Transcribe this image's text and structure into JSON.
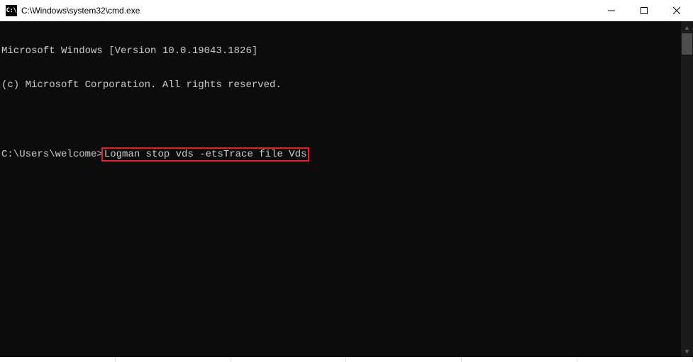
{
  "titlebar": {
    "icon_label": "C:\\",
    "title": "C:\\Windows\\system32\\cmd.exe"
  },
  "window_controls": {
    "minimize": "Minimize",
    "maximize": "Maximize",
    "close": "Close"
  },
  "terminal": {
    "line1": "Microsoft Windows [Version 10.0.19043.1826]",
    "line2": "(c) Microsoft Corporation. All rights reserved.",
    "blank": "",
    "prompt": "C:\\Users\\welcome>",
    "command": "Logman stop vds -etsTrace file Vds"
  }
}
